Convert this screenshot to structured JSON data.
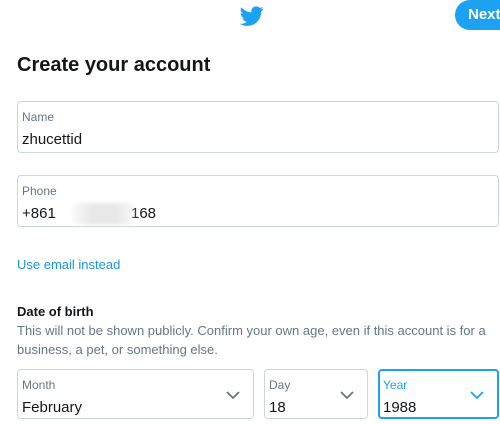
{
  "header": {
    "logo_icon": "twitter-bird-icon",
    "next_label": "Next"
  },
  "form": {
    "title": "Create your account",
    "name": {
      "label": "Name",
      "value": "zhucettid"
    },
    "phone": {
      "label": "Phone",
      "value_prefix": "+861",
      "value_suffix": "168"
    },
    "use_email_label": "Use email instead"
  },
  "dob": {
    "title": "Date of birth",
    "description": "This will not be shown publicly. Confirm your own age, even if this account is for a business, a pet, or something else.",
    "month": {
      "label": "Month",
      "value": "February"
    },
    "day": {
      "label": "Day",
      "value": "18"
    },
    "year": {
      "label": "Year",
      "value": "1988"
    }
  },
  "colors": {
    "accent": "#1da1f2",
    "link": "#1b95e0",
    "border": "#ccd6dd",
    "muted_text": "#657786"
  }
}
